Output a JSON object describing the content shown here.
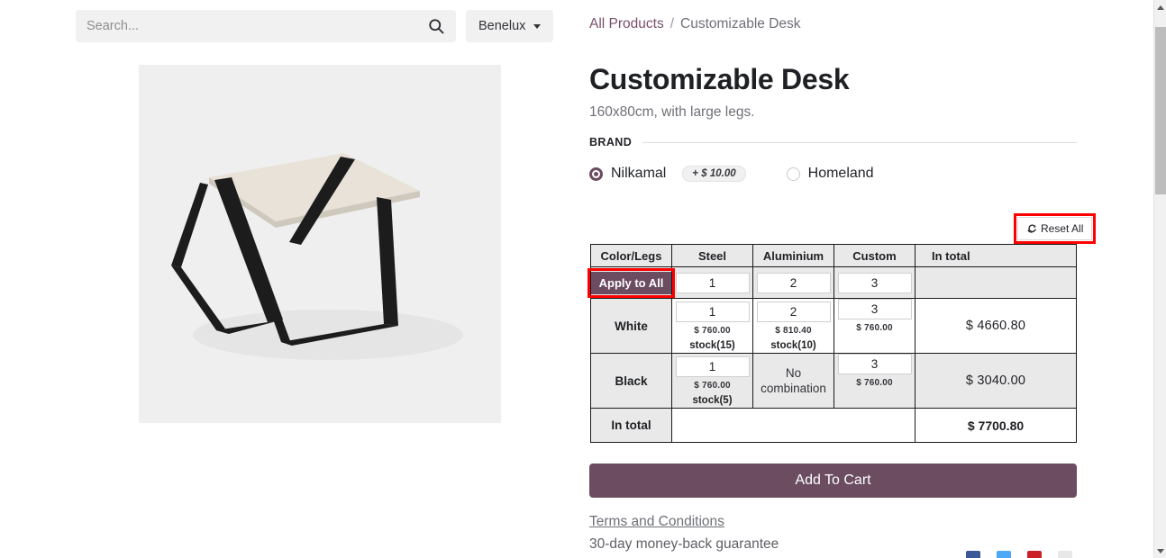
{
  "topbar": {
    "search": {
      "value": "",
      "placeholder": "Search...",
      "icon": "search-icon"
    },
    "region": {
      "label": "Benelux",
      "icon": "chevron-down-icon"
    }
  },
  "breadcrumb": {
    "parent": "All Products",
    "separator": "/",
    "current": "Customizable Desk"
  },
  "product": {
    "title": "Customizable Desk",
    "subtitle": "160x80cm, with large legs.",
    "image_alt": "customizable-desk-photo"
  },
  "attributes": {
    "legend": "BRAND",
    "options": [
      {
        "label": "Nilkamal",
        "selected": true,
        "extra_price": "$ 10.00",
        "plus": "+"
      },
      {
        "label": "Homeland",
        "selected": false
      }
    ]
  },
  "reset": {
    "label": "Reset All",
    "icon": "refresh-icon"
  },
  "matrix": {
    "headers": [
      "Color/Legs",
      "Steel",
      "Aluminium",
      "Custom",
      "In total",
      ""
    ],
    "apply_row": {
      "button_label": "Apply to All",
      "values": [
        "1",
        "2",
        "3"
      ],
      "total": ""
    },
    "rows": [
      {
        "color": "White",
        "cells": [
          {
            "type": "input",
            "value": "1",
            "price": "$ 760.00",
            "stock": "stock(15)"
          },
          {
            "type": "input",
            "value": "2",
            "price": "$ 810.40",
            "stock": "stock(10)"
          },
          {
            "type": "input",
            "value": "3",
            "price": "$ 760.00",
            "stock": ""
          }
        ],
        "total": "$ 4660.80"
      },
      {
        "color": "Black",
        "cells": [
          {
            "type": "input",
            "value": "1",
            "price": "$ 760.00",
            "stock": "stock(5)"
          },
          {
            "type": "none",
            "text": "No combination"
          },
          {
            "type": "input",
            "value": "3",
            "price": "$ 760.00",
            "stock": ""
          }
        ],
        "total": "$ 3040.00"
      }
    ],
    "footer": {
      "label": "In total",
      "grand_total": "$ 7700.80"
    }
  },
  "actions": {
    "add_to_cart": "Add To Cart",
    "terms": "Terms and Conditions",
    "guarantee": "30-day money-back guarantee"
  },
  "social": [
    {
      "name": "facebook-icon",
      "color": "#3b5998"
    },
    {
      "name": "twitter-icon",
      "color": "#4fa8f5"
    },
    {
      "name": "pinterest-icon",
      "color": "#cb2027"
    },
    {
      "name": "linkedin-icon",
      "color": "#e8e8e8"
    }
  ],
  "theme": {
    "accent": "#6b4c61",
    "highlight": "#ff0000",
    "header_gray": "#e9e9e9"
  }
}
